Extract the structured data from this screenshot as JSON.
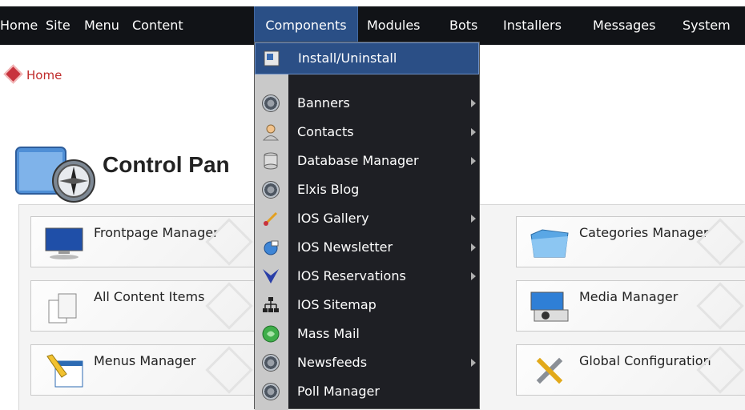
{
  "menubar": {
    "items": [
      "Home",
      "Site",
      "Menu",
      "Content",
      "Components",
      "Modules",
      "Bots",
      "Installers",
      "Messages",
      "System"
    ],
    "active": "Components"
  },
  "breadcrumb": {
    "label": "Home"
  },
  "page": {
    "title": "Control Pan"
  },
  "tiles": [
    {
      "label": "Frontpage Manager"
    },
    {
      "label": "Categories Manager"
    },
    {
      "label": "All Content Items"
    },
    {
      "label": "Media Manager"
    },
    {
      "label": "Menus Manager"
    },
    {
      "label": "Global Configuration"
    }
  ],
  "dropdown": {
    "header": "Install/Uninstall",
    "items": [
      {
        "label": "Banners",
        "submenu": true,
        "icon": "gear-icon"
      },
      {
        "label": "Contacts",
        "submenu": true,
        "icon": "contacts-icon"
      },
      {
        "label": "Database Manager",
        "submenu": true,
        "icon": "database-icon"
      },
      {
        "label": "Elxis Blog",
        "submenu": false,
        "icon": "gear-icon"
      },
      {
        "label": "IOS Gallery",
        "submenu": true,
        "icon": "brush-icon"
      },
      {
        "label": "IOS Newsletter",
        "submenu": true,
        "icon": "newsletter-icon"
      },
      {
        "label": "IOS Reservations",
        "submenu": true,
        "icon": "reservations-icon"
      },
      {
        "label": "IOS Sitemap",
        "submenu": false,
        "icon": "sitemap-icon"
      },
      {
        "label": "Mass Mail",
        "submenu": false,
        "icon": "mail-icon"
      },
      {
        "label": "Newsfeeds",
        "submenu": true,
        "icon": "gear-icon"
      },
      {
        "label": "Poll Manager",
        "submenu": false,
        "icon": "gear-icon"
      }
    ]
  },
  "colors": {
    "menubar": "#111317",
    "active": "#2a4f86",
    "dropdown": "#1e1f24"
  }
}
